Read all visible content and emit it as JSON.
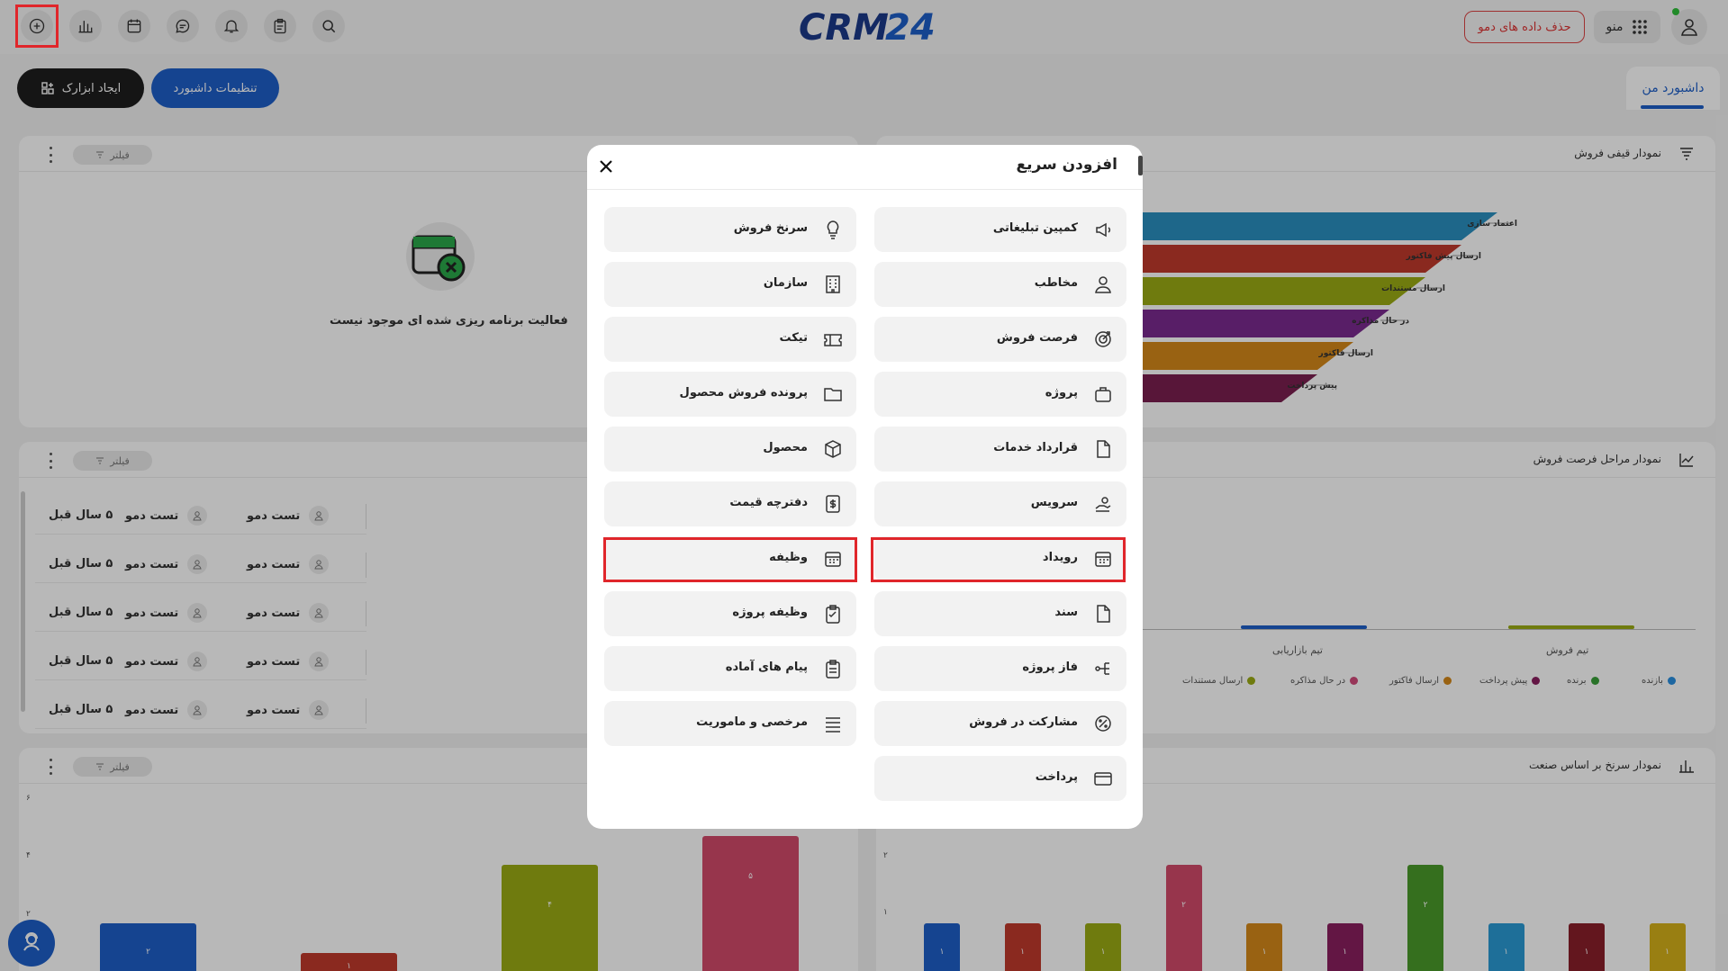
{
  "topbar": {
    "demo_delete_label": "حذف داده های دمو",
    "menu_label": "منو",
    "logo_text": "CRM24"
  },
  "toolbar": {
    "create_widget_label": "ایجاد ابزارک",
    "dashboard_settings_label": "تنظیمات داشبورد",
    "tab_my_dashboard": "داشبورد من"
  },
  "panels": {
    "filter_label": "فیلتر",
    "activity_empty_text": "فعالیت برنامه ریزی شده ای موجود نیست",
    "funnel_title": "نمودار قیفی فروش",
    "stages_title": "نمودار مراحل فرصت فروش",
    "industry_title": "نمودار سرنخ بر اساس صنعت"
  },
  "activity_rows": [
    {
      "time": "۵ سال قبل",
      "user1": "تست دمو",
      "user2": "تست دمو"
    },
    {
      "time": "۵ سال قبل",
      "user1": "تست دمو",
      "user2": "تست دمو"
    },
    {
      "time": "۵ سال قبل",
      "user1": "تست دمو",
      "user2": "تست دمو"
    },
    {
      "time": "۵ سال قبل",
      "user1": "تست دمو",
      "user2": "تست دمو"
    },
    {
      "time": "۵ سال قبل",
      "user1": "تست دمو",
      "user2": "تست دمو"
    }
  ],
  "funnel": {
    "labels": [
      "اعتماد سازی",
      "ارسال پیش فاکتور",
      "ارسال مستندات",
      "در حال مذاکره",
      "ارسال فاکتور",
      "پیش پرداخت"
    ],
    "colors": [
      "#2a8fbf",
      "#c0392b",
      "#9aab14",
      "#7b2a8f",
      "#d4881a",
      "#7a1f4f"
    ]
  },
  "stages_chart": {
    "teams": [
      "تیم بازاریابی",
      "تیم فروش"
    ],
    "legend": [
      {
        "name": "بازنده",
        "color": "#2a8fe0"
      },
      {
        "name": "برنده",
        "color": "#3aa03a"
      },
      {
        "name": "پیش پرداخت",
        "color": "#8a1f5f"
      },
      {
        "name": "ارسال فاکتور",
        "color": "#d4881a"
      },
      {
        "name": "در حال مذاکره",
        "color": "#d24a7a"
      },
      {
        "name": "ارسال مستندات",
        "color": "#9aab14"
      }
    ]
  },
  "chart_data": [
    {
      "type": "bar",
      "categories": [
        "",
        "",
        "",
        ""
      ],
      "values": [
        2,
        1,
        4,
        5
      ],
      "value_labels": [
        "۲",
        "۱",
        "۴",
        "۵"
      ],
      "colors": [
        "#1e5fc8",
        "#c0392b",
        "#9aab14",
        "#d24a6a"
      ],
      "y_ticks": [
        "۶",
        "۴",
        "۲"
      ],
      "ylim": [
        0,
        6
      ]
    },
    {
      "type": "bar",
      "categories": [
        "",
        "",
        "",
        "",
        "",
        "",
        "",
        "",
        "",
        ""
      ],
      "values": [
        1,
        1,
        1,
        2,
        1,
        1,
        2,
        1,
        1,
        1
      ],
      "value_labels": [
        "۱",
        "۱",
        "۱",
        "۲",
        "۱",
        "۱",
        "۲",
        "۱",
        "۱",
        "۱"
      ],
      "colors": [
        "#1e5fc8",
        "#c0392b",
        "#9aab14",
        "#d24a6a",
        "#d4881a",
        "#8a1f5f",
        "#4a9a2a",
        "#2a9ad4",
        "#8a1f2a",
        "#d4b01a"
      ],
      "y_ticks": [
        "۲",
        "۱"
      ],
      "ylim": [
        0,
        2
      ]
    }
  ],
  "modal": {
    "title": "افزودن سریع",
    "right_column": [
      {
        "label": "کمپین تبلیغاتی",
        "icon": "megaphone-icon"
      },
      {
        "label": "مخاطب",
        "icon": "person-icon"
      },
      {
        "label": "فرصت فروش",
        "icon": "target-icon"
      },
      {
        "label": "پروژه",
        "icon": "briefcase-icon"
      },
      {
        "label": "قرارداد خدمات",
        "icon": "document-icon"
      },
      {
        "label": "سرویس",
        "icon": "service-hand-icon"
      },
      {
        "label": "رویداد",
        "icon": "calendar-icon"
      },
      {
        "label": "سند",
        "icon": "file-icon"
      },
      {
        "label": "فاز پروژه",
        "icon": "phase-icon"
      },
      {
        "label": "مشارکت در فروش",
        "icon": "percent-icon"
      },
      {
        "label": "پرداخت",
        "icon": "credit-card-icon"
      }
    ],
    "left_column": [
      {
        "label": "سرنخ فروش",
        "icon": "lightbulb-icon"
      },
      {
        "label": "سازمان",
        "icon": "building-icon"
      },
      {
        "label": "تیکت",
        "icon": "ticket-icon"
      },
      {
        "label": "پرونده فروش محصول",
        "icon": "folder-icon"
      },
      {
        "label": "محصول",
        "icon": "box-icon"
      },
      {
        "label": "دفترچه قیمت",
        "icon": "price-book-icon"
      },
      {
        "label": "وظیفه",
        "icon": "task-calendar-icon"
      },
      {
        "label": "وظیفه پروژه",
        "icon": "clipboard-icon"
      },
      {
        "label": "پیام های آماده",
        "icon": "clipboard-list-icon"
      },
      {
        "label": "مرخصی و ماموریت",
        "icon": "list-icon"
      }
    ]
  }
}
